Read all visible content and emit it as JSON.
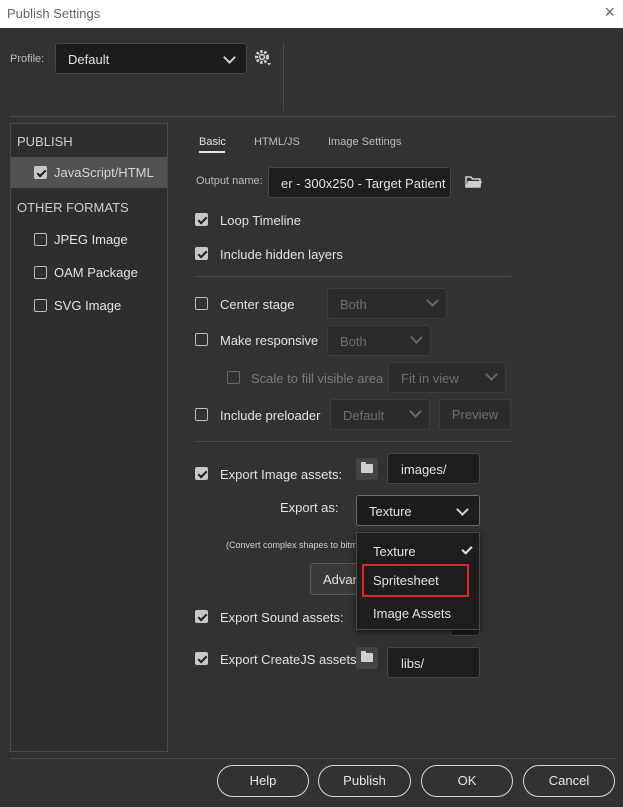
{
  "window": {
    "title": "Publish Settings",
    "close": "×"
  },
  "profile": {
    "label": "Profile:",
    "value": "Default"
  },
  "sidebar": {
    "publish_header": "PUBLISH",
    "publish_items": [
      {
        "label": "JavaScript/HTML",
        "checked": true
      }
    ],
    "other_header": "OTHER FORMATS",
    "other_items": [
      {
        "label": "JPEG Image",
        "checked": false
      },
      {
        "label": "OAM Package",
        "checked": false
      },
      {
        "label": "SVG Image",
        "checked": false
      }
    ]
  },
  "tabs": [
    "Basic",
    "HTML/JS",
    "Image Settings"
  ],
  "output": {
    "label": "Output name:",
    "value": "er - 300x250 - Target Patient"
  },
  "options": {
    "loop_timeline": "Loop Timeline",
    "include_hidden_layers": "Include hidden layers",
    "center_stage": "Center stage",
    "center_stage_value": "Both",
    "make_responsive": "Make responsive",
    "make_responsive_value": "Both",
    "scale_to_fill": "Scale to fill visible area",
    "scale_value": "Fit in view",
    "include_preloader": "Include preloader",
    "preloader_value": "Default",
    "preview": "Preview"
  },
  "export": {
    "image_assets_label": "Export Image assets:",
    "image_assets_path": "images/",
    "export_as_label": "Export as:",
    "export_as_value": "Texture",
    "convert_note": "(Convert complex shapes to bitm",
    "advanced": "Advan",
    "sound_assets_label": "Export Sound assets:",
    "createjs_assets_label": "Export CreateJS assets:",
    "createjs_path": "libs/"
  },
  "dropdown_menu": {
    "items": [
      "Texture",
      "Spritesheet",
      "Image Assets"
    ],
    "selected": "Texture",
    "highlighted": "Spritesheet",
    "highlight_color": "#e0242b"
  },
  "footer": {
    "help": "Help",
    "publish": "Publish",
    "ok": "OK",
    "cancel": "Cancel"
  }
}
